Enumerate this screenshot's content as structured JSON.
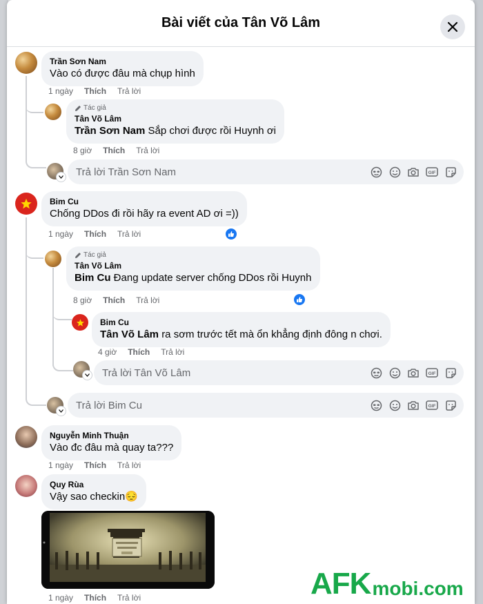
{
  "modal": {
    "title": "Bài viết của Tân Võ Lâm"
  },
  "comments": [
    {
      "author": "Trần Sơn Nam",
      "text": "Vào có được đâu mà chụp hình",
      "time": "1 ngày",
      "like_label": "Thích",
      "reply_label": "Trả lời",
      "replies": [
        {
          "author_tag": "Tác giả",
          "author": "Tân Võ Lâm",
          "mention": "Trần Sơn Nam",
          "text": "Sắp chơi được rồi Huynh ơi",
          "time": "8 giờ",
          "like_label": "Thích",
          "reply_label": "Trả lời"
        }
      ],
      "reply_box_placeholder": "Trả lời Trần Sơn Nam"
    },
    {
      "author": "Bim Cu",
      "text": "Chống DDos đi rồi hãy ra event AD ơi =))",
      "time": "1 ngày",
      "like_label": "Thích",
      "reply_label": "Trả lời",
      "replies": [
        {
          "author_tag": "Tác giả",
          "author": "Tân Võ Lâm",
          "mention": "Bim Cu",
          "text": "Đang update server chống DDos rồi Huynh",
          "time": "8 giờ",
          "like_label": "Thích",
          "reply_label": "Trả lời"
        },
        {
          "author": "Bim Cu",
          "mention": "Tân Võ Lâm",
          "text": "ra sơm trước tết mà ổn khẳng định đông n chơi.",
          "time": "4 giờ",
          "like_label": "Thích",
          "reply_label": "Trả lời"
        }
      ],
      "nested_reply_box_placeholder": "Trả lời Tân Võ Lâm",
      "reply_box_placeholder": "Trả lời Bim Cu"
    },
    {
      "author": "Nguyễn Minh Thuận",
      "text": "Vào đc đâu mà quay ta???",
      "time": "1 ngày",
      "like_label": "Thích",
      "reply_label": "Trả lời"
    },
    {
      "author": "Quy Rùa",
      "text": "Vậy sao checkin",
      "emoji": "😔",
      "time": "1 ngày",
      "like_label": "Thích",
      "reply_label": "Trả lời"
    }
  ],
  "reply_box_icons": [
    "avatar-sticker-icon",
    "emoji-icon",
    "camera-icon",
    "gif-icon",
    "sticker-icon"
  ],
  "watermark": {
    "brand": "AFK",
    "suffix": "mobi.com"
  },
  "colors": {
    "like_blue": "#1877f2",
    "bubble_bg": "#f0f2f5",
    "meta_gray": "#65676b",
    "watermark_green": "#18a84a",
    "flag_red": "#da251d"
  }
}
